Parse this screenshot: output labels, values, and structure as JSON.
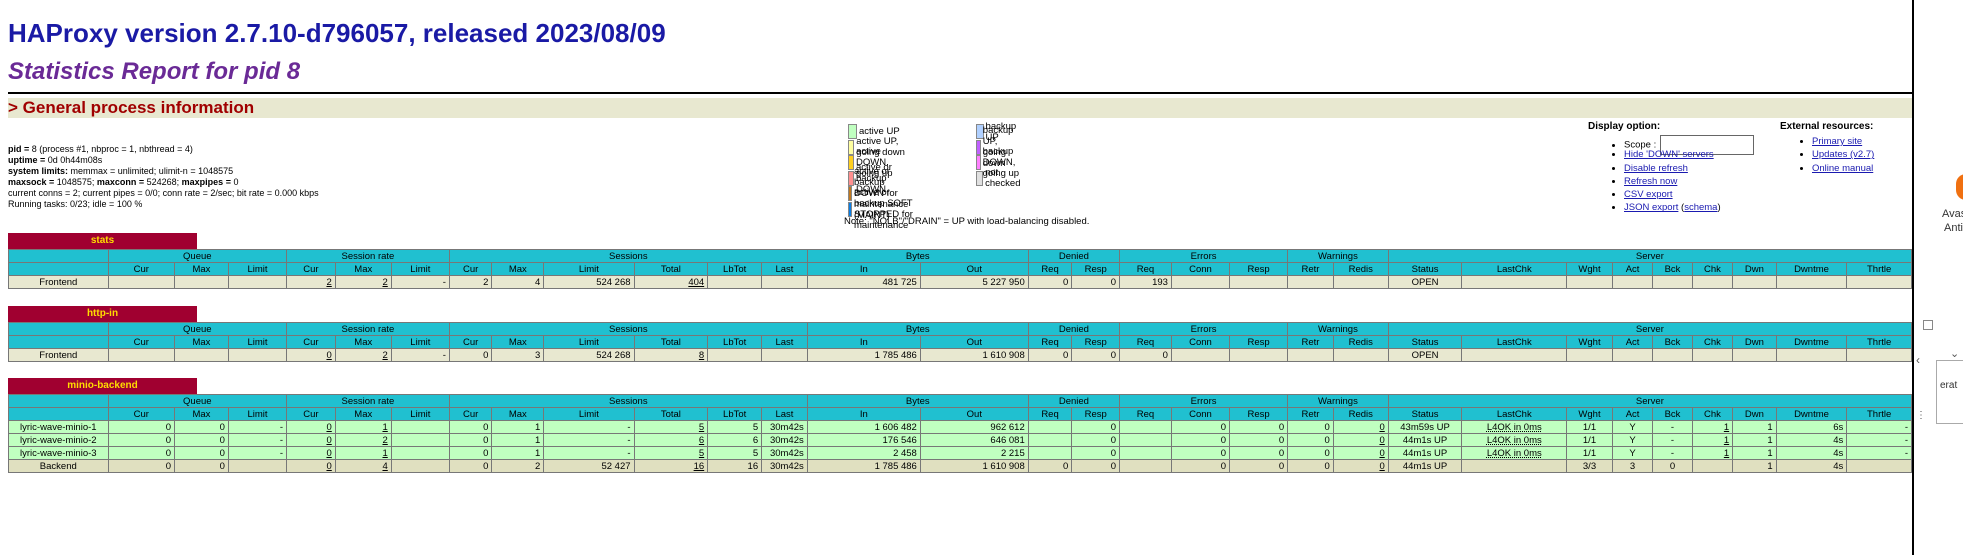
{
  "header": {
    "version": "HAProxy version 2.7.10-d796057, released 2023/08/09",
    "report": "Statistics Report for pid 8",
    "general_info": "> General process information"
  },
  "info": {
    "l1_b": "pid = ",
    "l1": "8 (process #1, nbproc = 1, nbthread = 4)",
    "l2_b": "uptime = ",
    "l2": "0d 0h44m08s",
    "l3_b": "system limits:",
    "l3": " memmax = unlimited; ulimit-n = 1048575",
    "l4_b1": "maxsock = ",
    "l4a": "1048575; ",
    "l4_b2": "maxconn = ",
    "l4b": "524268; ",
    "l4_b3": "maxpipes = ",
    "l4c": "0",
    "l5": "current conns = 2; current pipes = 0/0; conn rate = 2/sec; bit rate = 0.000 kbps",
    "l6": "Running tasks: 0/23; idle = 100 %"
  },
  "legend": {
    "left": [
      {
        "label": "active UP",
        "color": "#c0ffc0"
      },
      {
        "label": "active UP, going down",
        "color": "#ffffa0"
      },
      {
        "label": "active DOWN, going up",
        "color": "#ffd020"
      },
      {
        "label": "active or backup DOWN",
        "color": "#ff9090"
      },
      {
        "label": "active or backup DOWN for maintenance (MAINT)",
        "color": "#c07820"
      },
      {
        "label": "active or backup SOFT STOPPED for maintenance",
        "color": "#0b7ee3"
      }
    ],
    "right": [
      {
        "label": "backup UP",
        "color": "#b0d0ff"
      },
      {
        "label": "backup UP, going down",
        "color": "#c060ff"
      },
      {
        "label": "backup DOWN, going up",
        "color": "#ff80ff"
      },
      {
        "label": "not checked",
        "color": "#e0e0e0"
      }
    ],
    "note": "Note: \"NOLB\"/\"DRAIN\" = UP with load-balancing disabled."
  },
  "display": {
    "title": "Display option:",
    "scope_label": "Scope :",
    "scope_value": "",
    "links": [
      "Hide 'DOWN' servers",
      "Disable refresh",
      "Refresh now",
      "CSV export"
    ],
    "json": "JSON export",
    "schema": "schema"
  },
  "external": {
    "title": "External resources:",
    "links": [
      "Primary site",
      "Updates (v2.7)",
      "Online manual"
    ]
  },
  "headers": {
    "groups": [
      "Queue",
      "Session rate",
      "Sessions",
      "Bytes",
      "Denied",
      "Errors",
      "Warnings",
      "Server"
    ],
    "cols": [
      "Cur",
      "Max",
      "Limit",
      "Cur",
      "Max",
      "Limit",
      "Cur",
      "Max",
      "Limit",
      "Total",
      "LbTot",
      "Last",
      "In",
      "Out",
      "Req",
      "Resp",
      "Req",
      "Conn",
      "Resp",
      "Retr",
      "Redis",
      "Status",
      "LastChk",
      "Wght",
      "Act",
      "Bck",
      "Chk",
      "Dwn",
      "Dwntme",
      "Thrtle"
    ]
  },
  "proxies": [
    {
      "name": "stats",
      "rows": [
        {
          "kind": "fe",
          "cells": [
            "Frontend",
            "",
            "",
            "",
            "2",
            "2",
            "-",
            "2",
            "4",
            "524 268",
            "404",
            "",
            "",
            "481 725",
            "5 227 950",
            "0",
            "0",
            "193",
            "",
            "",
            "",
            "",
            "OPEN",
            "",
            "",
            "",
            "",
            "",
            "",
            "",
            ""
          ]
        }
      ]
    },
    {
      "name": "http-in",
      "rows": [
        {
          "kind": "fe",
          "cells": [
            "Frontend",
            "",
            "",
            "",
            "0",
            "2",
            "-",
            "0",
            "3",
            "524 268",
            "8",
            "",
            "",
            "1 785 486",
            "1 610 908",
            "0",
            "0",
            "0",
            "",
            "",
            "",
            "",
            "OPEN",
            "",
            "",
            "",
            "",
            "",
            "",
            "",
            ""
          ]
        }
      ]
    },
    {
      "name": "minio-backend",
      "rows": [
        {
          "kind": "up",
          "cells": [
            "lyric-wave-minio-1",
            "0",
            "0",
            "-",
            "0",
            "1",
            "",
            "0",
            "1",
            "-",
            "5",
            "5",
            "30m42s",
            "1 606 482",
            "962 612",
            "",
            "0",
            "",
            "0",
            "0",
            "0",
            "0",
            "43m59s UP",
            "L4OK in 0ms",
            "1/1",
            "Y",
            "-",
            "1",
            "1",
            "6s",
            "-"
          ]
        },
        {
          "kind": "up",
          "cells": [
            "lyric-wave-minio-2",
            "0",
            "0",
            "-",
            "0",
            "2",
            "",
            "0",
            "1",
            "-",
            "6",
            "6",
            "30m42s",
            "176 546",
            "646 081",
            "",
            "0",
            "",
            "0",
            "0",
            "0",
            "0",
            "44m1s UP",
            "L4OK in 0ms",
            "1/1",
            "Y",
            "-",
            "1",
            "1",
            "4s",
            "-"
          ]
        },
        {
          "kind": "up",
          "cells": [
            "lyric-wave-minio-3",
            "0",
            "0",
            "-",
            "0",
            "1",
            "",
            "0",
            "1",
            "-",
            "5",
            "5",
            "30m42s",
            "2 458",
            "2 215",
            "",
            "0",
            "",
            "0",
            "0",
            "0",
            "0",
            "44m1s UP",
            "L4OK in 0ms",
            "1/1",
            "Y",
            "-",
            "1",
            "1",
            "4s",
            "-"
          ]
        },
        {
          "kind": "be",
          "cells": [
            "Backend",
            "0",
            "0",
            "",
            "0",
            "4",
            "",
            "0",
            "2",
            "52 427",
            "16",
            "16",
            "30m42s",
            "1 785 486",
            "1 610 908",
            "0",
            "0",
            "",
            "0",
            "0",
            "0",
            "0",
            "44m1s UP",
            "",
            "3/3",
            "3",
            "0",
            "",
            "1",
            "4s",
            ""
          ]
        }
      ]
    }
  ],
  "rightbar": {
    "t1": "Avas",
    "t2": "Anti",
    "t3": "erat"
  }
}
